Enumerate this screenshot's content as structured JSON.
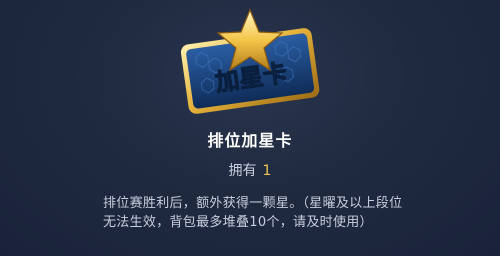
{
  "item": {
    "card_text": "加星卡",
    "name": "排位加星卡",
    "own_label": "拥有",
    "own_count": "1",
    "description": "排位赛胜利后，额外获得一颗星。（星曜及以上段位无法生效，背包最多堆叠10个，请及时使用）",
    "icon": "star-card-icon"
  },
  "colors": {
    "background": "#1f2a3f",
    "gold": "#f0c550",
    "card_face": "#1a3f77"
  }
}
